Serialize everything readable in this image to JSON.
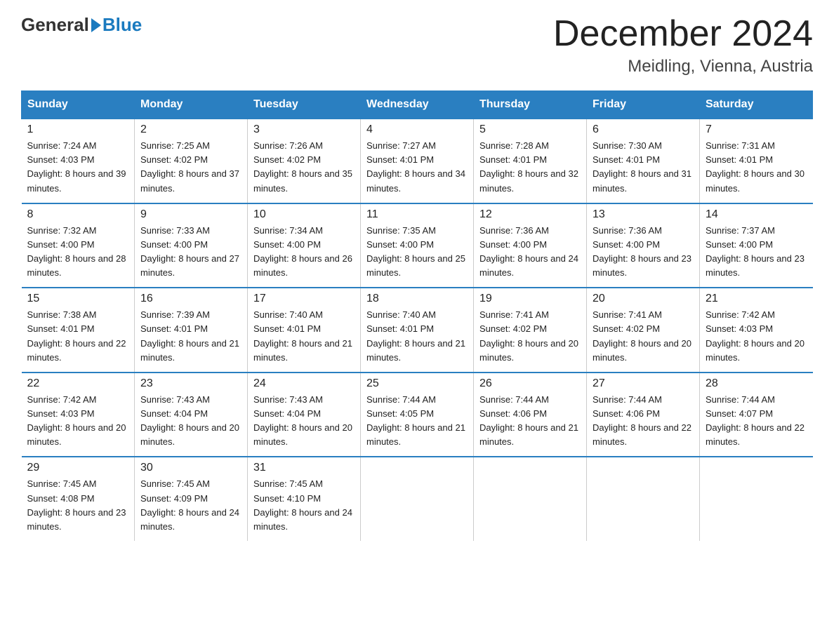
{
  "header": {
    "logo_general": "General",
    "logo_blue": "Blue",
    "month_title": "December 2024",
    "location": "Meidling, Vienna, Austria"
  },
  "days_of_week": [
    "Sunday",
    "Monday",
    "Tuesday",
    "Wednesday",
    "Thursday",
    "Friday",
    "Saturday"
  ],
  "weeks": [
    [
      {
        "day": "1",
        "sunrise": "7:24 AM",
        "sunset": "4:03 PM",
        "daylight": "8 hours and 39 minutes."
      },
      {
        "day": "2",
        "sunrise": "7:25 AM",
        "sunset": "4:02 PM",
        "daylight": "8 hours and 37 minutes."
      },
      {
        "day": "3",
        "sunrise": "7:26 AM",
        "sunset": "4:02 PM",
        "daylight": "8 hours and 35 minutes."
      },
      {
        "day": "4",
        "sunrise": "7:27 AM",
        "sunset": "4:01 PM",
        "daylight": "8 hours and 34 minutes."
      },
      {
        "day": "5",
        "sunrise": "7:28 AM",
        "sunset": "4:01 PM",
        "daylight": "8 hours and 32 minutes."
      },
      {
        "day": "6",
        "sunrise": "7:30 AM",
        "sunset": "4:01 PM",
        "daylight": "8 hours and 31 minutes."
      },
      {
        "day": "7",
        "sunrise": "7:31 AM",
        "sunset": "4:01 PM",
        "daylight": "8 hours and 30 minutes."
      }
    ],
    [
      {
        "day": "8",
        "sunrise": "7:32 AM",
        "sunset": "4:00 PM",
        "daylight": "8 hours and 28 minutes."
      },
      {
        "day": "9",
        "sunrise": "7:33 AM",
        "sunset": "4:00 PM",
        "daylight": "8 hours and 27 minutes."
      },
      {
        "day": "10",
        "sunrise": "7:34 AM",
        "sunset": "4:00 PM",
        "daylight": "8 hours and 26 minutes."
      },
      {
        "day": "11",
        "sunrise": "7:35 AM",
        "sunset": "4:00 PM",
        "daylight": "8 hours and 25 minutes."
      },
      {
        "day": "12",
        "sunrise": "7:36 AM",
        "sunset": "4:00 PM",
        "daylight": "8 hours and 24 minutes."
      },
      {
        "day": "13",
        "sunrise": "7:36 AM",
        "sunset": "4:00 PM",
        "daylight": "8 hours and 23 minutes."
      },
      {
        "day": "14",
        "sunrise": "7:37 AM",
        "sunset": "4:00 PM",
        "daylight": "8 hours and 23 minutes."
      }
    ],
    [
      {
        "day": "15",
        "sunrise": "7:38 AM",
        "sunset": "4:01 PM",
        "daylight": "8 hours and 22 minutes."
      },
      {
        "day": "16",
        "sunrise": "7:39 AM",
        "sunset": "4:01 PM",
        "daylight": "8 hours and 21 minutes."
      },
      {
        "day": "17",
        "sunrise": "7:40 AM",
        "sunset": "4:01 PM",
        "daylight": "8 hours and 21 minutes."
      },
      {
        "day": "18",
        "sunrise": "7:40 AM",
        "sunset": "4:01 PM",
        "daylight": "8 hours and 21 minutes."
      },
      {
        "day": "19",
        "sunrise": "7:41 AM",
        "sunset": "4:02 PM",
        "daylight": "8 hours and 20 minutes."
      },
      {
        "day": "20",
        "sunrise": "7:41 AM",
        "sunset": "4:02 PM",
        "daylight": "8 hours and 20 minutes."
      },
      {
        "day": "21",
        "sunrise": "7:42 AM",
        "sunset": "4:03 PM",
        "daylight": "8 hours and 20 minutes."
      }
    ],
    [
      {
        "day": "22",
        "sunrise": "7:42 AM",
        "sunset": "4:03 PM",
        "daylight": "8 hours and 20 minutes."
      },
      {
        "day": "23",
        "sunrise": "7:43 AM",
        "sunset": "4:04 PM",
        "daylight": "8 hours and 20 minutes."
      },
      {
        "day": "24",
        "sunrise": "7:43 AM",
        "sunset": "4:04 PM",
        "daylight": "8 hours and 20 minutes."
      },
      {
        "day": "25",
        "sunrise": "7:44 AM",
        "sunset": "4:05 PM",
        "daylight": "8 hours and 21 minutes."
      },
      {
        "day": "26",
        "sunrise": "7:44 AM",
        "sunset": "4:06 PM",
        "daylight": "8 hours and 21 minutes."
      },
      {
        "day": "27",
        "sunrise": "7:44 AM",
        "sunset": "4:06 PM",
        "daylight": "8 hours and 22 minutes."
      },
      {
        "day": "28",
        "sunrise": "7:44 AM",
        "sunset": "4:07 PM",
        "daylight": "8 hours and 22 minutes."
      }
    ],
    [
      {
        "day": "29",
        "sunrise": "7:45 AM",
        "sunset": "4:08 PM",
        "daylight": "8 hours and 23 minutes."
      },
      {
        "day": "30",
        "sunrise": "7:45 AM",
        "sunset": "4:09 PM",
        "daylight": "8 hours and 24 minutes."
      },
      {
        "day": "31",
        "sunrise": "7:45 AM",
        "sunset": "4:10 PM",
        "daylight": "8 hours and 24 minutes."
      },
      null,
      null,
      null,
      null
    ]
  ]
}
